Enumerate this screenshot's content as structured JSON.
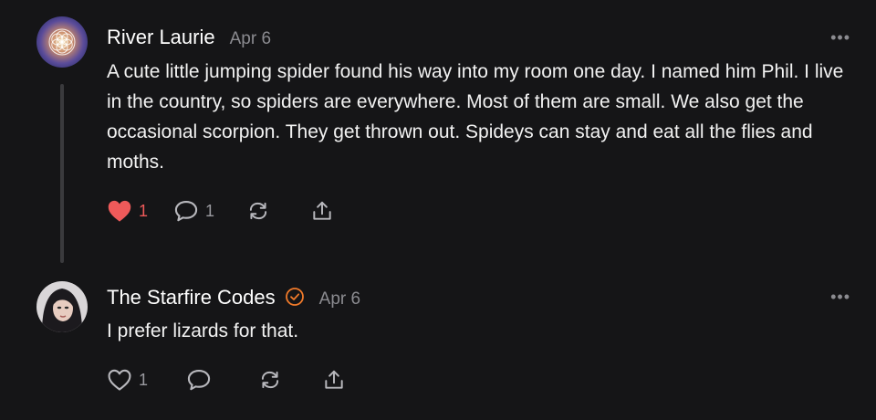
{
  "comments": [
    {
      "author": "River Laurie",
      "date": "Apr 6",
      "text": "A cute little jumping spider found his way into my room one day. I named him Phil. I live in the country, so spiders are everywhere. Most of them are small. We also get the occasional scorpion. They get thrown out. Spideys can stay and eat all the flies and moths.",
      "likes": "1",
      "replies": "1",
      "liked": true,
      "more_label": "•••"
    },
    {
      "author": "The Starfire Codes",
      "date": "Apr 6",
      "text": "I prefer lizards for that.",
      "likes": "1",
      "liked": false,
      "verified": true,
      "more_label": "•••"
    }
  ],
  "colors": {
    "background": "#151517",
    "like_active": "#ef5a5a",
    "verified_badge": "#f07a2a",
    "muted": "#8b8b90"
  },
  "icons": [
    "heart-icon",
    "comment-icon",
    "restack-icon",
    "share-icon",
    "verified-icon",
    "more-icon"
  ]
}
